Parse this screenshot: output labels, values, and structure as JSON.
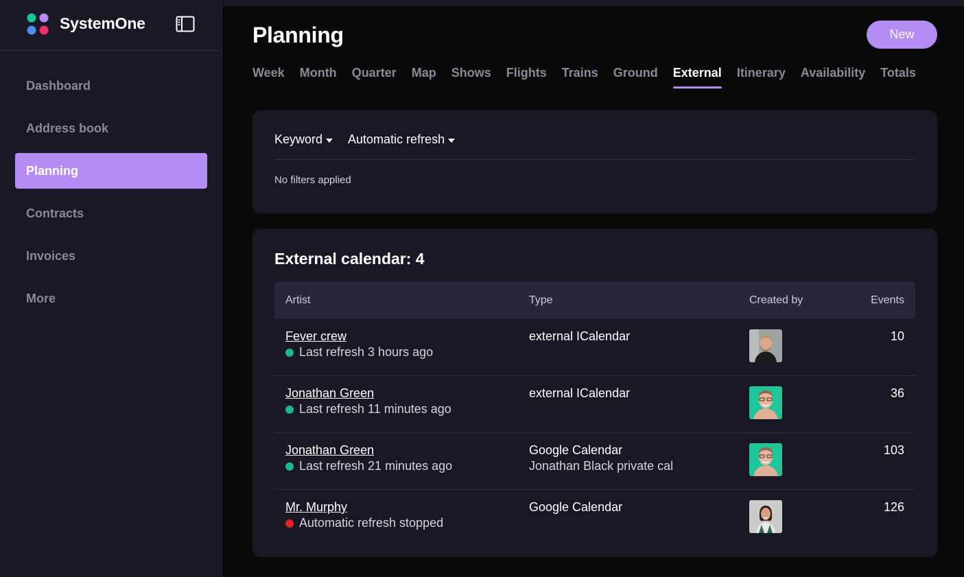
{
  "brand": {
    "name": "SystemOne",
    "logo_icon": "systemone-logo-icon",
    "toggle_icon": "sidebar-toggle-icon"
  },
  "sidebar": {
    "items": [
      {
        "label": "Dashboard",
        "active": false
      },
      {
        "label": "Address book",
        "active": false
      },
      {
        "label": "Planning",
        "active": true
      },
      {
        "label": "Contracts",
        "active": false
      },
      {
        "label": "Invoices",
        "active": false
      },
      {
        "label": "More",
        "active": false
      }
    ]
  },
  "header": {
    "title": "Planning",
    "new_label": "New"
  },
  "tabs": [
    {
      "label": "Week"
    },
    {
      "label": "Month"
    },
    {
      "label": "Quarter"
    },
    {
      "label": "Map"
    },
    {
      "label": "Shows"
    },
    {
      "label": "Flights"
    },
    {
      "label": "Trains"
    },
    {
      "label": "Ground"
    },
    {
      "label": "External",
      "active": true
    },
    {
      "label": "Itinerary"
    },
    {
      "label": "Availability"
    },
    {
      "label": "Totals"
    }
  ],
  "filters": {
    "keyword_label": "Keyword",
    "refresh_label": "Automatic refresh",
    "status": "No filters applied"
  },
  "table": {
    "title": "External calendar: 4",
    "columns": {
      "artist": "Artist",
      "type": "Type",
      "created_by": "Created by",
      "events": "Events"
    },
    "rows": [
      {
        "artist": "Fever crew",
        "status": "Last refresh 3 hours ago",
        "status_color": "#1db592",
        "type": "external ICalendar",
        "type_sub": "",
        "avatar": "avatar-man-gray-bg",
        "events": "10"
      },
      {
        "artist": "Jonathan Green",
        "status": "Last refresh 11 minutes ago",
        "status_color": "#1db592",
        "type": "external ICalendar",
        "type_sub": "",
        "avatar": "avatar-man-green-bg",
        "events": "36"
      },
      {
        "artist": "Jonathan Green",
        "status": "Last refresh 21 minutes ago",
        "status_color": "#1db592",
        "type": "Google Calendar",
        "type_sub": "Jonathan Black private cal",
        "avatar": "avatar-man-green-bg",
        "events": "103"
      },
      {
        "artist": "Mr. Murphy",
        "status": "Automatic refresh stopped",
        "status_color": "#e5241f",
        "type": "Google Calendar",
        "type_sub": "",
        "avatar": "avatar-woman-light-bg",
        "events": "126"
      }
    ]
  },
  "colors": {
    "accent": "#b38cf4",
    "sidebar_bg": "#1b1826",
    "card_bg": "#1b1826",
    "page_bg": "#0a0a0b",
    "ok": "#1db592",
    "error": "#e5241f"
  }
}
